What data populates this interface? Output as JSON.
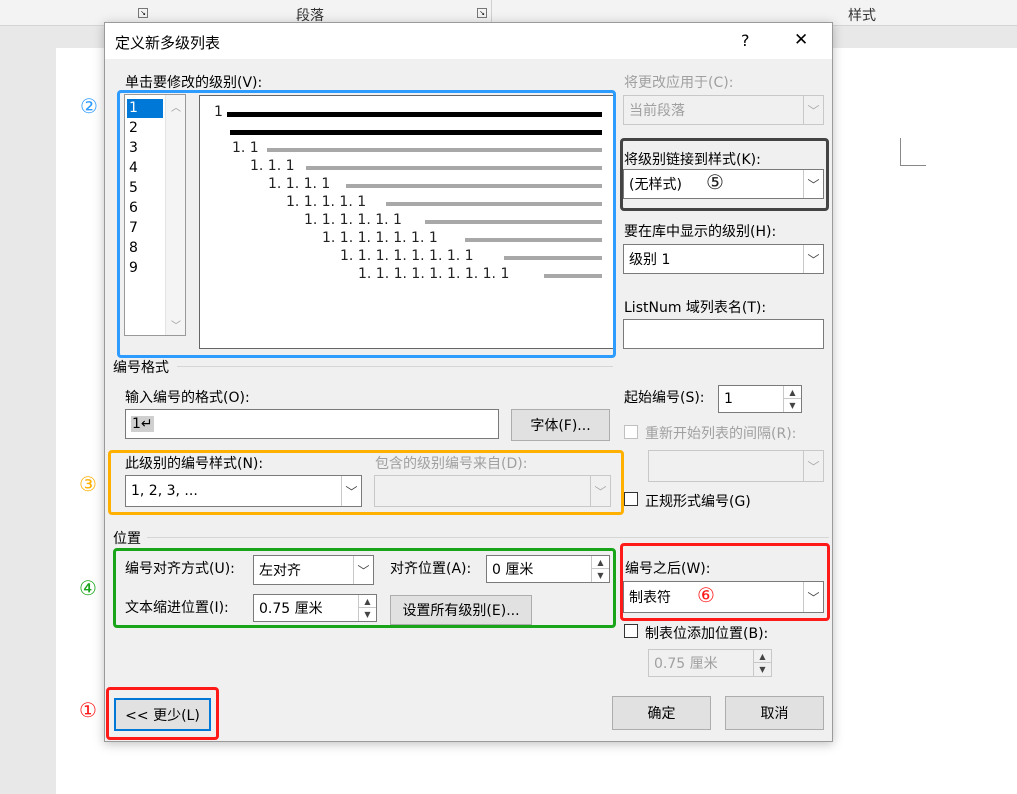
{
  "background": {
    "ribbon_paragraph": "段落",
    "ribbon_styles": "样式"
  },
  "dialog": {
    "title": "定义新多级列表",
    "help": "?",
    "close": "✕"
  },
  "levels": {
    "label": "单击要修改的级别(V):",
    "items": [
      "1",
      "2",
      "3",
      "4",
      "5",
      "6",
      "7",
      "8",
      "9"
    ],
    "selected": "1"
  },
  "preview": {
    "rows": [
      "1",
      "",
      "1. 1",
      "1. 1. 1",
      "1. 1. 1. 1",
      "1. 1. 1. 1. 1",
      "1. 1. 1. 1. 1. 1",
      "1. 1. 1. 1. 1. 1. 1",
      "1. 1. 1. 1. 1. 1. 1. 1",
      "1. 1. 1. 1. 1. 1. 1. 1. 1"
    ]
  },
  "apply_to": {
    "label": "将更改应用于(C):",
    "value": "当前段落"
  },
  "link_style": {
    "label": "将级别链接到样式(K):",
    "value": "(无样式)"
  },
  "gallery_level": {
    "label": "要在库中显示的级别(H):",
    "value": "级别 1"
  },
  "listnum": {
    "label": "ListNum 域列表名(T):",
    "value": ""
  },
  "number_format": {
    "section": "编号格式",
    "format_label": "输入编号的格式(O):",
    "format_value": "1↵",
    "font_button": "字体(F)...",
    "style_label": "此级别的编号样式(N):",
    "style_value": "1, 2, 3, ...",
    "include_label": "包含的级别编号来自(D):",
    "include_value": ""
  },
  "start_at": {
    "label": "起始编号(S):",
    "value": "1"
  },
  "restart": {
    "label": "重新开始列表的间隔(R):",
    "value": ""
  },
  "legal": {
    "label": "正规形式编号(G)"
  },
  "position": {
    "section": "位置",
    "align_label": "编号对齐方式(U):",
    "align_value": "左对齐",
    "aligned_at_label": "对齐位置(A):",
    "aligned_at_value": "0 厘米",
    "indent_label": "文本缩进位置(I):",
    "indent_value": "0.75 厘米",
    "set_all_button": "设置所有级别(E)..."
  },
  "follow": {
    "label": "编号之后(W):",
    "value": "制表符"
  },
  "tab_stop": {
    "label": "制表位添加位置(B):",
    "value": "0.75 厘米"
  },
  "buttons": {
    "less": "<< 更少(L)",
    "ok": "确定",
    "cancel": "取消"
  },
  "annotations": [
    "①",
    "②",
    "③",
    "④",
    "⑤",
    "⑥"
  ],
  "colors": {
    "blue": "#2e9bff",
    "orange": "#ffb000",
    "green": "#19a519",
    "red": "#ff1a1a",
    "dark": "#444444"
  }
}
